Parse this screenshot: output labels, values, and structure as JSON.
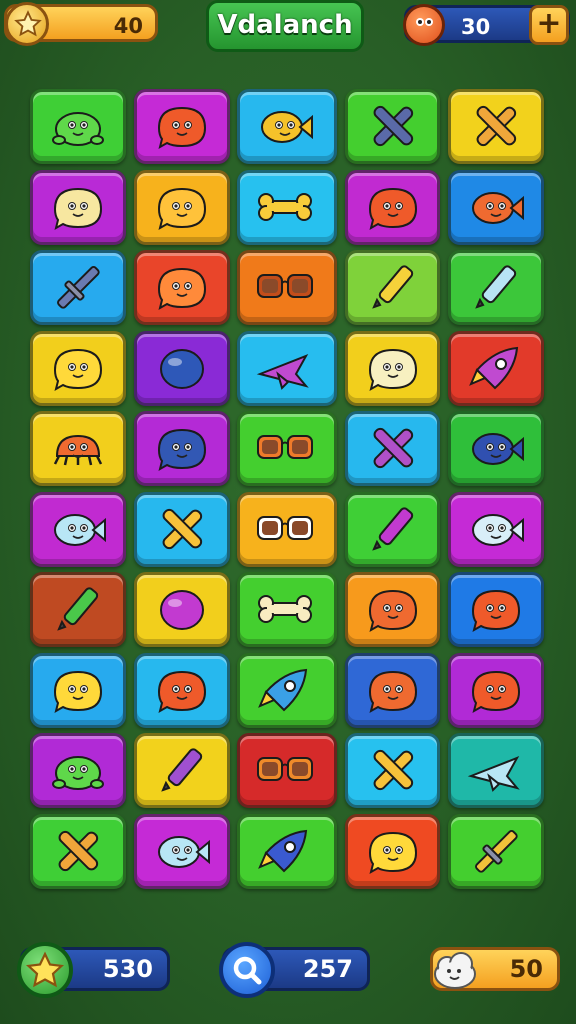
{
  "header": {
    "coins": {
      "value": "40",
      "icon": "star-icon"
    },
    "title": "Vdalanch",
    "lives": {
      "value": "30",
      "icon": "creature-icon",
      "add_label": "+"
    }
  },
  "footer": {
    "score": {
      "value": "530",
      "icon": "star-icon"
    },
    "search": {
      "value": "257",
      "icon": "magnifier-icon"
    },
    "bonus": {
      "value": "50",
      "icon": "cloud-creature-icon"
    }
  },
  "board": {
    "rows": 10,
    "cols": 5,
    "tiles": [
      {
        "bg": "#3fcf36",
        "icon": "frog",
        "color": "#5fd84a"
      },
      {
        "bg": "#c52ad6",
        "icon": "blob",
        "color": "#ef5a2a"
      },
      {
        "bg": "#27b8ee",
        "icon": "fish",
        "color": "#f5c22a"
      },
      {
        "bg": "#44cf2f",
        "icon": "cross",
        "color": "#5a6aa8"
      },
      {
        "bg": "#f2d21c",
        "icon": "cross",
        "color": "#f0a63a"
      },
      {
        "bg": "#b92ad6",
        "icon": "blob",
        "color": "#f7e7a0"
      },
      {
        "bg": "#f7b21c",
        "icon": "blob",
        "color": "#ffc23a"
      },
      {
        "bg": "#27c1ef",
        "icon": "bone",
        "color": "#f8cc3a"
      },
      {
        "bg": "#c12ad1",
        "icon": "blob",
        "color": "#ef5a2a"
      },
      {
        "bg": "#1f89e6",
        "icon": "fish",
        "color": "#ef6a30"
      },
      {
        "bg": "#27aaee",
        "icon": "sword",
        "color": "#6a7ab0"
      },
      {
        "bg": "#e9452a",
        "icon": "blob",
        "color": "#ff8a3a"
      },
      {
        "bg": "#f07a1a",
        "icon": "glasses",
        "color": "#c34d1a"
      },
      {
        "bg": "#7fd23a",
        "icon": "crayon",
        "color": "#f5d23a"
      },
      {
        "bg": "#3cc73a",
        "icon": "crayon",
        "color": "#b8e4f5"
      },
      {
        "bg": "#f2cf1c",
        "icon": "blob",
        "color": "#ffd93a"
      },
      {
        "bg": "#8a2ad6",
        "icon": "ball",
        "color": "#2e58b8"
      },
      {
        "bg": "#27bdef",
        "icon": "plane",
        "color": "#c04ad0"
      },
      {
        "bg": "#f2cf1c",
        "icon": "blob",
        "color": "#f7f0c0"
      },
      {
        "bg": "#e23a2a",
        "icon": "rocket",
        "color": "#c04ad0"
      },
      {
        "bg": "#f2cf1c",
        "icon": "crab",
        "color": "#ef6a30"
      },
      {
        "bg": "#b42ad6",
        "icon": "blob",
        "color": "#3258b4"
      },
      {
        "bg": "#44cf2f",
        "icon": "glasses",
        "color": "#ef7a2a"
      },
      {
        "bg": "#27b8ee",
        "icon": "cross",
        "color": "#b050c8"
      },
      {
        "bg": "#2fbf3a",
        "icon": "fish",
        "color": "#3050b0"
      },
      {
        "bg": "#c12ad1",
        "icon": "fish",
        "color": "#b8e6f5"
      },
      {
        "bg": "#27b8ee",
        "icon": "cross",
        "color": "#f7c23a"
      },
      {
        "bg": "#f7b21c",
        "icon": "glasses",
        "color": "#ffffff"
      },
      {
        "bg": "#3fcf36",
        "icon": "crayon",
        "color": "#c23ad0"
      },
      {
        "bg": "#c52ad6",
        "icon": "fish",
        "color": "#d8eef8"
      },
      {
        "bg": "#bf4a22",
        "icon": "crayon",
        "color": "#4ac84a"
      },
      {
        "bg": "#f2cf1c",
        "icon": "ball",
        "color": "#c23ad0"
      },
      {
        "bg": "#44cf2f",
        "icon": "bone",
        "color": "#f8ecc0"
      },
      {
        "bg": "#f79a1c",
        "icon": "blob",
        "color": "#ef6a30"
      },
      {
        "bg": "#1f7ae6",
        "icon": "blob",
        "color": "#ef5a2a"
      },
      {
        "bg": "#27aaee",
        "icon": "blob",
        "color": "#ffd93a"
      },
      {
        "bg": "#27b8ee",
        "icon": "blob",
        "color": "#ef5a2a"
      },
      {
        "bg": "#44cf2f",
        "icon": "rocket",
        "color": "#3aa0e6"
      },
      {
        "bg": "#2f68d6",
        "icon": "blob",
        "color": "#ef6a30"
      },
      {
        "bg": "#b12ad6",
        "icon": "blob",
        "color": "#ef5a2a"
      },
      {
        "bg": "#b12ad6",
        "icon": "frog",
        "color": "#5fd84a"
      },
      {
        "bg": "#f2d21c",
        "icon": "crayon",
        "color": "#a050d0"
      },
      {
        "bg": "#d62a2a",
        "icon": "glasses",
        "color": "#ef8a2a"
      },
      {
        "bg": "#27c1ef",
        "icon": "cross",
        "color": "#f7c23a"
      },
      {
        "bg": "#1fb8a8",
        "icon": "plane",
        "color": "#b8e6f5"
      },
      {
        "bg": "#3fcf36",
        "icon": "cross",
        "color": "#f0a63a"
      },
      {
        "bg": "#c52ad6",
        "icon": "fish",
        "color": "#b8e6f5"
      },
      {
        "bg": "#44cf2f",
        "icon": "rocket",
        "color": "#3a5ad0"
      },
      {
        "bg": "#ef4a22",
        "icon": "blob",
        "color": "#ffd93a"
      },
      {
        "bg": "#44cf2f",
        "icon": "sword",
        "color": "#f0c23a"
      }
    ]
  }
}
